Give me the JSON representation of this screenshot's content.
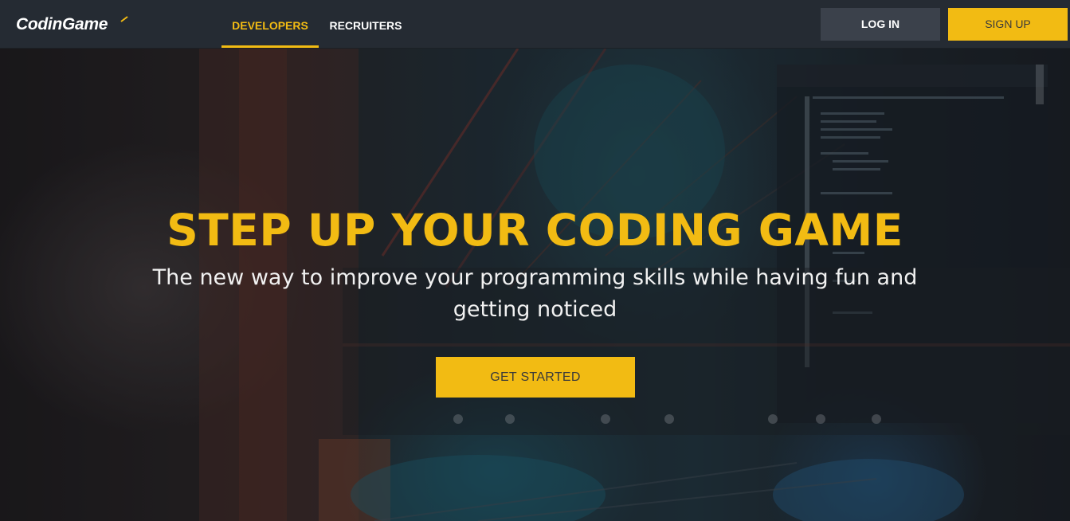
{
  "brand": {
    "logo_text_a": "Codin",
    "logo_text_b": "Game",
    "logo_accent_color": "#f2bb13"
  },
  "nav": {
    "tabs": [
      {
        "label": "DEVELOPERS",
        "active": true
      },
      {
        "label": "RECRUITERS",
        "active": false
      }
    ],
    "login_label": "LOG IN",
    "signup_label": "SIGN UP"
  },
  "hero": {
    "title": "STEP UP YOUR CODING GAME",
    "subtitle": "The new way to improve your programming skills while having fun and getting noticed",
    "cta_label": "GET STARTED"
  },
  "colors": {
    "accent": "#f2bb13",
    "navbar_bg": "#252b33",
    "login_bg": "#3b414b"
  }
}
